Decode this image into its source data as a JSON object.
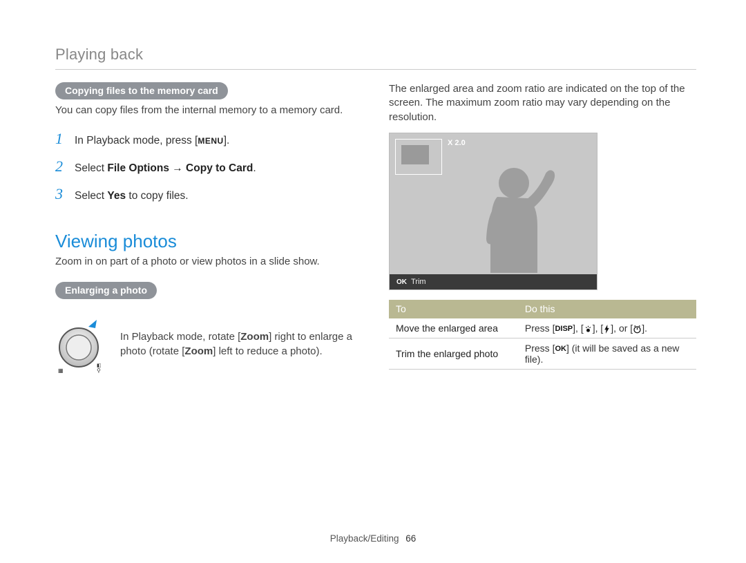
{
  "header": {
    "section": "Playing back"
  },
  "left": {
    "copy_card": {
      "heading": "Copying files to the memory card",
      "intro": "You can copy files from the internal memory to a memory card.",
      "steps": [
        {
          "num": "1",
          "pre": "In Playback mode, press [",
          "btn": "MENU",
          "post": "]."
        },
        {
          "num": "2",
          "pre": "Select ",
          "bold": "File Options → Copy to Card",
          "post": "."
        },
        {
          "num": "3",
          "pre": "Select ",
          "bold": "Yes",
          "post": " to copy files."
        }
      ]
    },
    "viewing": {
      "heading": "Viewing photos",
      "intro": "Zoom in on part of a photo or view photos in a slide show.",
      "enlarge_heading": "Enlarging a photo",
      "enlarge_text_a": "In Playback mode, rotate ",
      "enlarge_text_zoom1": "Zoom",
      "enlarge_text_b": " right to enlarge a photo (rotate ",
      "enlarge_text_zoom2": "Zoom",
      "enlarge_text_c": " left to reduce a photo)."
    }
  },
  "right": {
    "intro": "The enlarged area and zoom ratio are indicated on the top of the screen. The maximum zoom ratio may vary depending on the resolution.",
    "lcd": {
      "zoom": "X 2.0",
      "ok": "OK",
      "trim": "Trim"
    },
    "table": {
      "h1": "To",
      "h2": "Do this",
      "r1c1": "Move the enlarged area",
      "r1c2_a": "Press [",
      "r1c2_disp": "DISP",
      "r1c2_b": "], [",
      "r1c2_c": "], [",
      "r1c2_d": "], or [",
      "r1c2_e": "].",
      "r2c1": "Trim the enlarged photo",
      "r2c2_a": "Press [",
      "r2c2_ok": "OK",
      "r2c2_b": "] (it will be saved as a new file)."
    }
  },
  "footer": {
    "label": "Playback/Editing",
    "page": "66"
  }
}
